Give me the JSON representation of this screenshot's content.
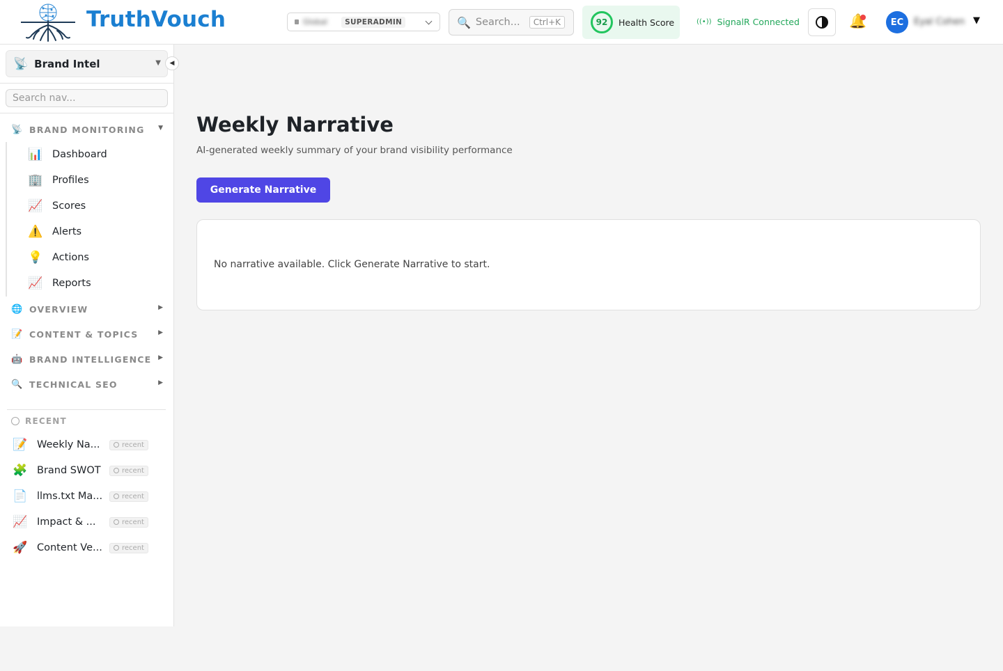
{
  "app": {
    "brand_name": "TruthVouch"
  },
  "header": {
    "tenant": {
      "name": "Global",
      "role": "SUPERADMIN"
    },
    "search": {
      "placeholder": "Search...",
      "shortcut": "Ctrl+K"
    },
    "health": {
      "score": "92",
      "label": "Health Score",
      "color": "#22c55e"
    },
    "connection": {
      "label": "SignalR Connected",
      "color": "#22a75a"
    },
    "user": {
      "initials": "EC",
      "name": "Eyal Cohen"
    }
  },
  "sidebar": {
    "module": {
      "icon": "📡",
      "label": "Brand Intel"
    },
    "nav_search_placeholder": "Search nav...",
    "groups": [
      {
        "icon": "📡",
        "label": "BRAND MONITORING",
        "expanded": true
      },
      {
        "icon": "🌐",
        "label": "OVERVIEW",
        "expanded": false
      },
      {
        "icon": "📝",
        "label": "CONTENT & TOPICS",
        "expanded": false
      },
      {
        "icon": "🤖",
        "label": "BRAND INTELLIGENCE",
        "expanded": false
      },
      {
        "icon": "🔍",
        "label": "TECHNICAL SEO",
        "expanded": false
      }
    ],
    "items": [
      {
        "icon": "📊",
        "label": "Dashboard"
      },
      {
        "icon": "🏢",
        "label": "Profiles"
      },
      {
        "icon": "📈",
        "label": "Scores"
      },
      {
        "icon": "⚠️",
        "label": "Alerts"
      },
      {
        "icon": "💡",
        "label": "Actions"
      },
      {
        "icon": "📈",
        "label": "Reports"
      }
    ],
    "recent_label": "RECENT",
    "recent": [
      {
        "icon": "📝",
        "label": "Weekly Na...",
        "badge": "recent"
      },
      {
        "icon": "🧩",
        "label": "Brand SWOT",
        "badge": "recent"
      },
      {
        "icon": "📄",
        "label": "llms.txt Ma...",
        "badge": "recent"
      },
      {
        "icon": "📈",
        "label": "Impact & ...",
        "badge": "recent"
      },
      {
        "icon": "🚀",
        "label": "Content Ve...",
        "badge": "recent"
      }
    ]
  },
  "main": {
    "title": "Weekly Narrative",
    "subtitle": "AI-generated weekly summary of your brand visibility performance",
    "generate_button": "Generate Narrative",
    "empty_state": "No narrative available. Click Generate Narrative to start."
  },
  "colors": {
    "brand": "#1b7fd1",
    "primary_button": "#4f46e5",
    "avatar": "#1d6fe0"
  }
}
